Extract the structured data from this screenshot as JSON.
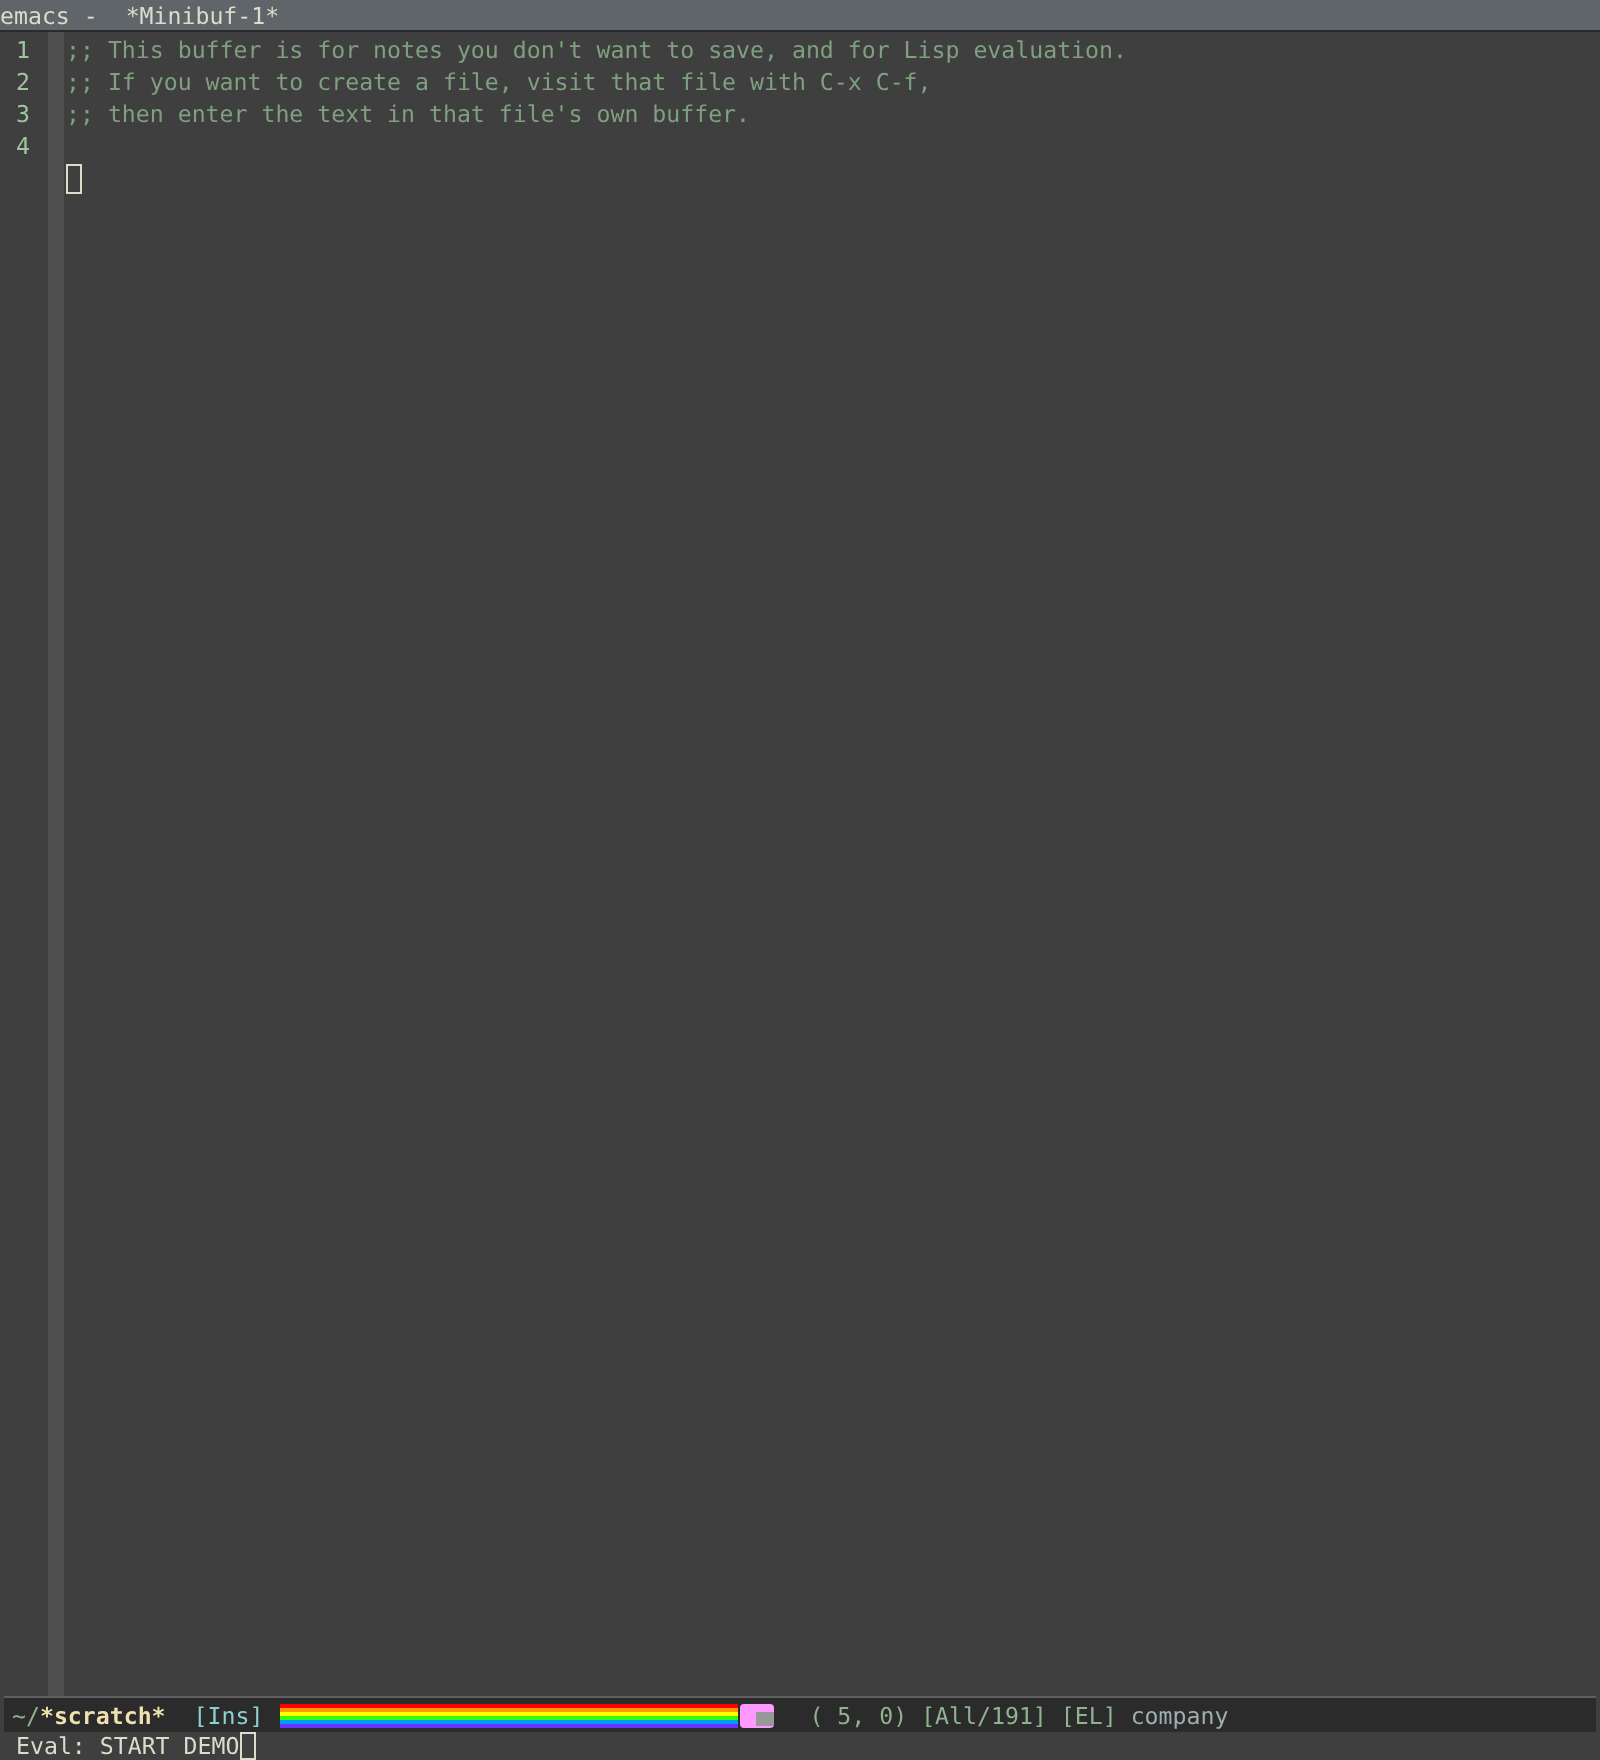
{
  "window": {
    "title": "emacs -  *Minibuf-1*"
  },
  "buffer": {
    "lines": [
      {
        "number": "1",
        "text": ";; This buffer is for notes you don't want to save, and for Lisp evaluation."
      },
      {
        "number": "2",
        "text": ";; If you want to create a file, visit that file with C-x C-f,"
      },
      {
        "number": "3",
        "text": ";; then enter the text in that file's own buffer."
      },
      {
        "number": "4"
      }
    ]
  },
  "mode_line": {
    "directory": "~/",
    "buffer_name": "*scratch*",
    "state": "[Ins]",
    "position": "( 5, 0)",
    "extent": "[All/191]",
    "mode": "[EL]",
    "minor_mode": "company"
  },
  "minibuffer": {
    "prompt": "Eval: ",
    "value": "START DEMO"
  }
}
